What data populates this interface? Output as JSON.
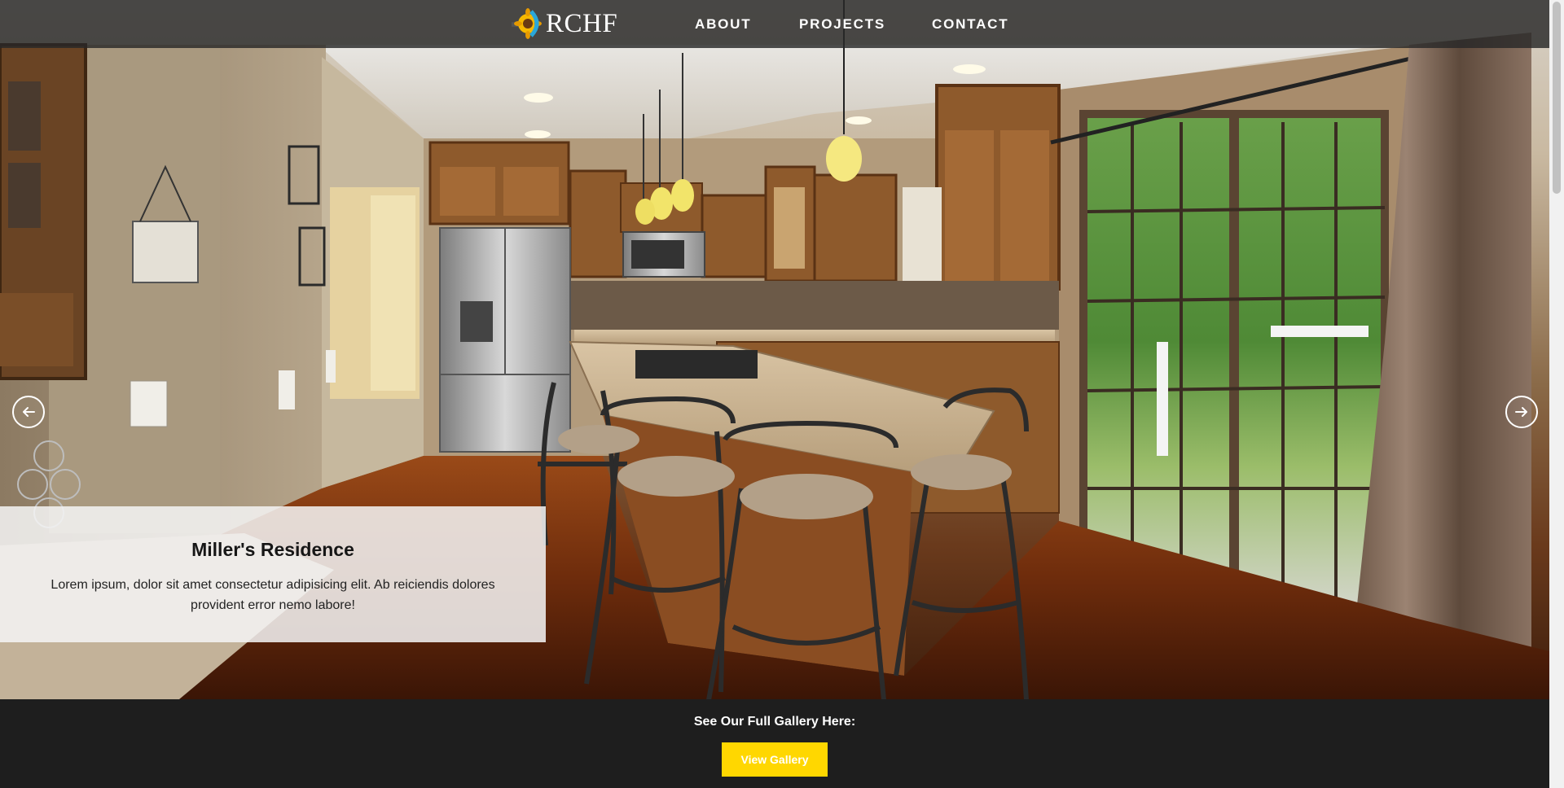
{
  "brand": {
    "logo_text": "RCHF",
    "logo_icon": "sunflower-logo-icon"
  },
  "nav": {
    "items": [
      {
        "label": "ABOUT"
      },
      {
        "label": "PROJECTS"
      },
      {
        "label": "CONTACT"
      }
    ]
  },
  "slider": {
    "current_slide": {
      "title": "Miller's Residence",
      "description": "Lorem ipsum, dolor sit amet consectetur adipisicing elit. Ab reiciendis dolores provident error nemo labore!",
      "image": "kitchen-photo"
    },
    "prev_icon": "arrow-left-icon",
    "next_icon": "arrow-right-icon"
  },
  "gallery": {
    "heading": "See Our Full Gallery Here:",
    "button_label": "View Gallery"
  },
  "colors": {
    "nav_bg": "#282828",
    "accent": "#ffd700",
    "footer_bg": "#1e1e1e",
    "caption_bg": "#f5f5f5"
  }
}
